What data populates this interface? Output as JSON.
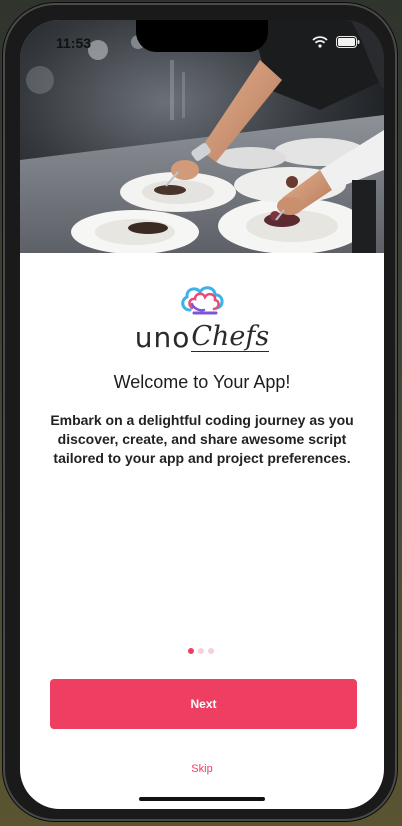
{
  "status_bar": {
    "time": "11:53",
    "icons": [
      "wifi-icon",
      "battery-icon"
    ]
  },
  "hero": {
    "icon": "chef-plating-photo"
  },
  "logo": {
    "icon": "chef-hat-icon",
    "brand_uno": "uno",
    "brand_chefs": "Chefs"
  },
  "onboarding": {
    "title": "Welcome to Your App!",
    "description": "Embark on a delightful coding journey as you discover, create, and share awesome script tailored to your app and project preferences.",
    "pager": {
      "total": 3,
      "active_index": 0
    }
  },
  "actions": {
    "next_label": "Next",
    "skip_label": "Skip"
  },
  "colors": {
    "accent": "#ee3f62",
    "dot_inactive": "#f5d2db",
    "text": "#1d1d1d",
    "background": "#ffffff"
  }
}
